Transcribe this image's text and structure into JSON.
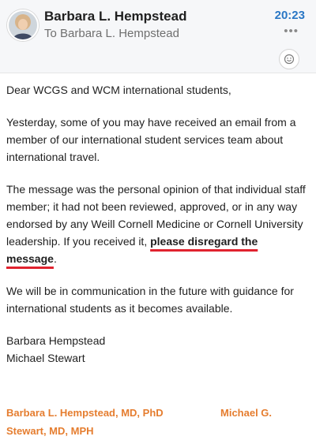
{
  "header": {
    "sender": "Barbara L. Hempstead",
    "recipient": "To Barbara L. Hempstead",
    "time": "20:23",
    "more_icon": "more-horizontal-icon",
    "reaction_icon": "smiley-icon",
    "accent": "#2a77c5"
  },
  "email": {
    "greeting": "Dear WCGS and WCM international students,",
    "paragraph_1": "Yesterday, some of you may have received an email from a member of our international student services team about international travel.",
    "paragraph_2_before": "The message was the personal opinion of that individual staff member; it had not been reviewed, approved, or in any way endorsed by any Weill Cornell Medicine or Cornell University leadership. If you received it, ",
    "paragraph_2_highlight": "please disregard the message",
    "paragraph_2_after": ".",
    "paragraph_3": "We will be in communication in the future with guidance for international students as it becomes available.",
    "signer_1": "Barbara Hempstead",
    "signer_2": "Michael Stewart",
    "signature_left": "Barbara L. Hempstead, MD, PhD",
    "signature_right": "Michael G.",
    "signature_continued": "Stewart, MD, MPH",
    "signature_color": "#e57d2f",
    "highlight_underline_color": "#e0222e"
  }
}
